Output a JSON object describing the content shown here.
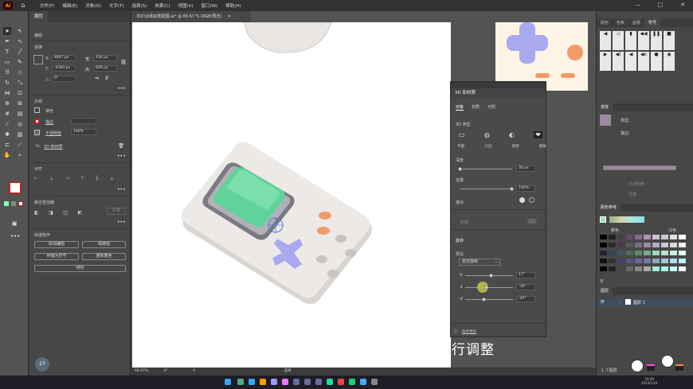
{
  "app": {
    "logo": "Ai",
    "home_icon": "home-icon"
  },
  "menu": [
    "文件(F)",
    "编辑(E)",
    "对象(O)",
    "文字(T)",
    "选择(S)",
    "效果(C)",
    "视图(V)",
    "窗口(W)",
    "帮助(H)"
  ],
  "window_controls": [
    "—",
    "□",
    "✕"
  ],
  "document": {
    "tab_title": "3D凸出和斜角配图.ai* @ 66.67 % (RGB/预览)",
    "tab_close": "✕"
  },
  "properties_panel": {
    "tabs": [
      "属性"
    ],
    "group_label": "编组",
    "transform_title": "变换",
    "x_label": "X:",
    "x_value": "4847 px",
    "y_label": "Y:",
    "y_value": "-4360 px",
    "w_label": "宽:",
    "w_value": "434 px",
    "h_label": "高:",
    "h_value": "600 px",
    "angle_label": "△:",
    "angle_value": "0°",
    "appearance_title": "外观",
    "fill_label": "填色",
    "stroke_label": "描边",
    "opacity_label": "不透明度",
    "opacity_value": "100%",
    "fx_label": "fx.",
    "effect_name": "3D 和材质",
    "align_title": "对齐",
    "pathfinder_title": "路径查找器",
    "expand_label": "扩展",
    "quick_actions_title": "快速操作",
    "btn_ungroup": "取消编组",
    "btn_isolate": "隔离组",
    "btn_save_symbol": "存储为符号",
    "btn_recolor": "重新着色",
    "btn_arrange": "排列",
    "more": "•••"
  },
  "status_bar": {
    "zoom": "66.67%",
    "angle": "0°",
    "page": "4",
    "tool": "选择"
  },
  "subtitle": "行调整",
  "panel_3d": {
    "title": "3D 和材质",
    "tabs": [
      "对象",
      "材质",
      "光照"
    ],
    "type_label": "3D 类型",
    "type_options": [
      "平面",
      "凸出",
      "绕转",
      "膨胀"
    ],
    "depth_label": "深度",
    "depth_value": "30 px",
    "volume_label": "音量",
    "volume_value": "100%",
    "cap_label": "端点",
    "bevel_label": "斜角",
    "rotation_title": "旋转",
    "preset_label": "预设",
    "preset_value": "自定旋转",
    "rot_x_value": "17°",
    "rot_y_value": "-30°",
    "rot_z_value": "-45°",
    "footer_label": "技术预览",
    "depth_level": 0.0,
    "volume_level": 1.0,
    "rot_x_level": 0.55,
    "rot_y_level": 0.45,
    "rot_z_level": 0.4
  },
  "right_panel": {
    "tabs_top": [
      "颜色",
      "色板",
      "画笔",
      "符号"
    ],
    "gradient_tab": "渐变",
    "gradient_type_label": "类型:",
    "stroke_label": "描边:",
    "opacity_label": "不透明度",
    "position_label": "位置",
    "color_ref_tab": "颜色参考",
    "warm_label": "暖色",
    "cool_label": "冷色",
    "none_label": "无",
    "layers_tab": "图层",
    "layer_name": "图层 1",
    "layers_count": "1 个图层",
    "swatch_colors": [
      "#000000",
      "#222222",
      "#444444",
      "#6a4a6a",
      "#8a6a8a",
      "#b090b8",
      "#d0c0d8",
      "#c8c8d0",
      "#e0e0e8",
      "#ffffff"
    ]
  },
  "zoom_badge": "27",
  "clock": {
    "time": "19:46",
    "date": "2023/1/24"
  },
  "colors": {
    "screen_green": "#5fd39a",
    "console_body": "#ece9e6",
    "dpad": "#a9a9f0",
    "buttons": "#f29a6a",
    "gradient_swatch": "#9e8aa0"
  }
}
